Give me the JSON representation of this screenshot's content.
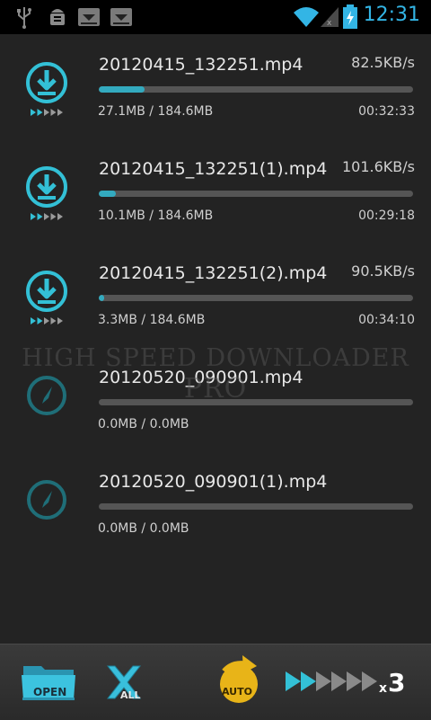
{
  "status_bar": {
    "time": "12:31",
    "colors": {
      "accent": "#33b5e5"
    }
  },
  "downloads": [
    {
      "filename": "20120415_132251.mp4",
      "rate": "82.5KB/s",
      "sizes": "27.1MB / 184.6MB",
      "eta": "00:32:33",
      "progress": 0.147,
      "state": "downloading"
    },
    {
      "filename": "20120415_132251(1).mp4",
      "rate": "101.6KB/s",
      "sizes": "10.1MB / 184.6MB",
      "eta": "00:29:18",
      "progress": 0.055,
      "state": "downloading"
    },
    {
      "filename": "20120415_132251(2).mp4",
      "rate": "90.5KB/s",
      "sizes": "3.3MB / 184.6MB",
      "eta": "00:34:10",
      "progress": 0.018,
      "state": "downloading"
    },
    {
      "filename": "20120520_090901.mp4",
      "rate": "",
      "sizes": "0.0MB / 0.0MB",
      "eta": "",
      "progress": 0,
      "state": "waiting"
    },
    {
      "filename": "20120520_090901(1).mp4",
      "rate": "",
      "sizes": "0.0MB / 0.0MB",
      "eta": "",
      "progress": 0,
      "state": "waiting"
    }
  ],
  "watermark": {
    "line1": "HIGH SPEED DOWNLOADER",
    "line2": "PRO"
  },
  "toolbar": {
    "open_label": "OPEN",
    "all_label": "ALL",
    "auto_label": "AUTO",
    "speed_multiplier_prefix": "x",
    "speed_multiplier": "3",
    "speed_level": 3,
    "speed_level_max": 6
  },
  "colors": {
    "progress": "#33aabf",
    "icon_active": "#33c0d6",
    "icon_waiting": "#1f6e78",
    "auto_gold": "#e8b418"
  }
}
